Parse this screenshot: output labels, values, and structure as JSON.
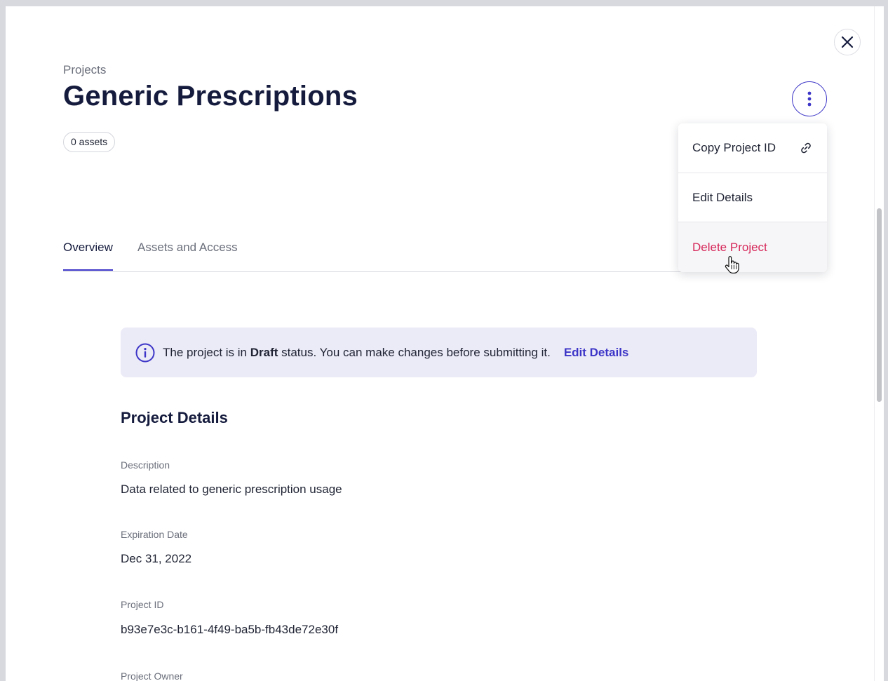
{
  "header": {
    "breadcrumb": "Projects",
    "title": "Generic Prescriptions",
    "assets_badge": "0 assets"
  },
  "tabs": [
    {
      "label": "Overview",
      "active": true
    },
    {
      "label": "Assets and Access",
      "active": false
    }
  ],
  "menu": {
    "items": [
      {
        "label": "Copy Project ID",
        "icon": "link-icon"
      },
      {
        "label": "Edit Details"
      },
      {
        "label": "Delete Project",
        "hovered": true
      }
    ]
  },
  "banner": {
    "icon": "info-icon",
    "prefix": "The project is in ",
    "status": "Draft",
    "suffix": " status. You can make changes before submitting it.",
    "link": "Edit Details"
  },
  "details": {
    "title": "Project Details",
    "fields": [
      {
        "label": "Description",
        "value": "Data related to generic prescription usage"
      },
      {
        "label": "Expiration Date",
        "value": "Dec 31, 2022"
      },
      {
        "label": "Project ID",
        "value": "b93e7e3c-b161-4f49-ba5b-fb43de72e30f"
      },
      {
        "label": "Project Owner",
        "value": ""
      }
    ]
  },
  "colors": {
    "accent": "#3c35c7",
    "danger": "#d6285a",
    "title": "#151b3d",
    "banner_bg": "#ebeaf7"
  }
}
